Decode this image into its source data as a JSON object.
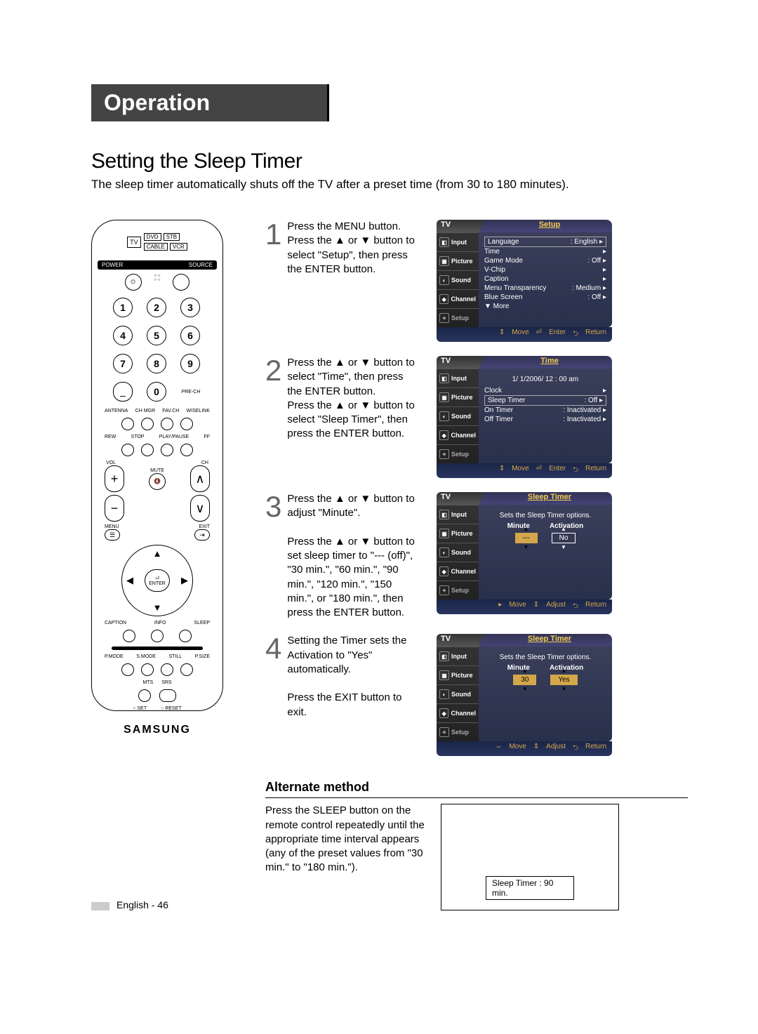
{
  "header": "Operation",
  "title": "Setting the Sleep Timer",
  "desc": "The sleep timer automatically shuts off the TV after a preset time (from 30 to 180 minutes).",
  "remote": {
    "tv": "TV",
    "devices": {
      "dvd": "DVD",
      "stb": "STB",
      "cable": "CABLE",
      "vcr": "VCR"
    },
    "power": "POWER",
    "source": "SOURCE",
    "numpad": [
      "1",
      "2",
      "3",
      "4",
      "5",
      "6",
      "7",
      "8",
      "9"
    ],
    "zero": "0",
    "prech": "PRE-CH",
    "row_labels": [
      "ANTENNA",
      "CH MGR",
      "FAV.CH",
      "WISELINK"
    ],
    "play_labels": [
      "REW",
      "STOP",
      "PLAY/PAUSE",
      "FF"
    ],
    "vol": "VOL",
    "ch": "CH",
    "mute": "MUTE",
    "menu": "MENU",
    "exit": "EXIT",
    "enter": "ENTER",
    "caption": "CAPTION",
    "info": "INFO",
    "sleep": "SLEEP",
    "bottom_row": [
      "P.MODE",
      "S.MODE",
      "STILL",
      "P.SIZE"
    ],
    "mts": "MTS",
    "srs": "SRS",
    "set": "SET",
    "reset": "RESET",
    "brand": "SAMSUNG"
  },
  "osd": {
    "tv": "TV",
    "nav": [
      "Input",
      "Picture",
      "Sound",
      "Channel",
      "Setup"
    ],
    "footer_move": "Move",
    "footer_enter": "Enter",
    "footer_return": "Return",
    "footer_adjust": "Adjust"
  },
  "steps": {
    "s1": {
      "num": "1",
      "text": "Press the MENU button.\nPress the ▲ or ▼ button to select \"Setup\", then press the ENTER button.",
      "osd_title": "Setup",
      "lines": [
        [
          "Language",
          ": English"
        ],
        [
          "Time",
          ""
        ],
        [
          "Game Mode",
          ": Off"
        ],
        [
          "V-Chip",
          ""
        ],
        [
          "Caption",
          ""
        ],
        [
          "Menu Transparency",
          ": Medium"
        ],
        [
          "Blue Screen",
          ": Off"
        ],
        [
          "▼ More",
          ""
        ]
      ]
    },
    "s2": {
      "num": "2",
      "text": "Press the ▲ or ▼ button to select \"Time\", then press the ENTER button.\nPress the ▲ or ▼ button to select \"Sleep Timer\", then press the ENTER button.",
      "osd_title": "Time",
      "date": "1/  1/2006/ 12 : 00 am",
      "lines": [
        [
          "Clock",
          ""
        ],
        [
          "Sleep Timer",
          ": Off"
        ],
        [
          "On Timer",
          ": Inactivated"
        ],
        [
          "Off Timer",
          ": Inactivated"
        ]
      ]
    },
    "s3": {
      "num": "3",
      "text": "Press the ▲ or ▼ button to adjust \"Minute\".\n\nPress the ▲ or ▼ button to set sleep timer to \"--- (off)\", \"30 min.\", \"60 min.\", \"90 min.\", \"120 min.\", \"150 min.\", or \"180 min.\", then press the ENTER button.",
      "osd_title": "Sleep Timer",
      "subtitle": "Sets the Sleep Timer options.",
      "labels": [
        "Minute",
        "Activation"
      ],
      "vals": [
        "---",
        "No"
      ]
    },
    "s4": {
      "num": "4",
      "text": "Setting the Timer sets the Activation to \"Yes\" automatically.\n\nPress the EXIT button to exit.",
      "osd_title": "Sleep Timer",
      "subtitle": "Sets the Sleep Timer options.",
      "labels": [
        "Minute",
        "Activation"
      ],
      "vals": [
        "30",
        "Yes"
      ]
    }
  },
  "alt": {
    "heading": "Alternate method",
    "text": "Press the SLEEP button on the remote control repeatedly until the appropriate time interval appears (any of the preset values from \"30 min.\" to \"180 min.\").",
    "label": "Sleep Timer : 90 min."
  },
  "footer": "English - 46"
}
